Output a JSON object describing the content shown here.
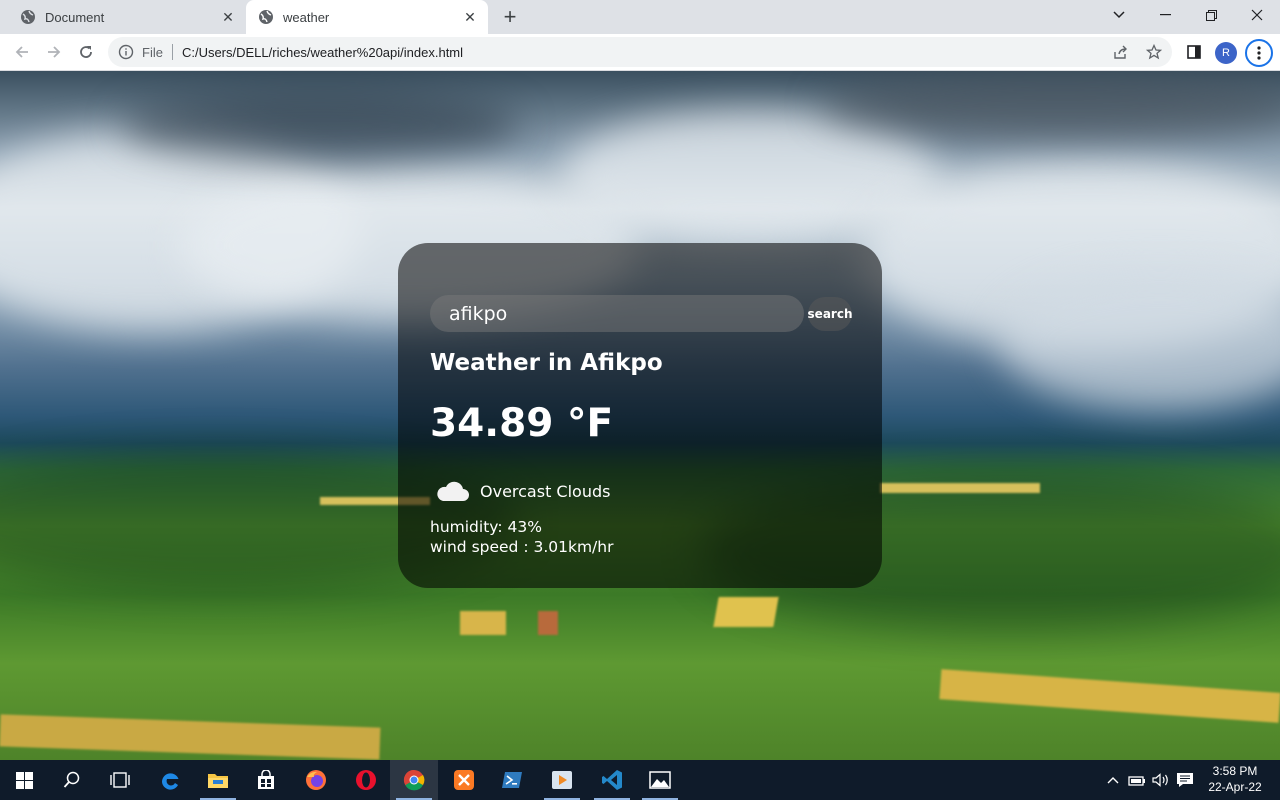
{
  "browser": {
    "tabs": [
      {
        "title": "Document",
        "active": false
      },
      {
        "title": "weather",
        "active": true
      }
    ],
    "new_tab_label": "+",
    "address": {
      "scheme_label": "File",
      "url": "C:/Users/DELL/riches/weather%20api/index.html"
    },
    "profile_initial": "R"
  },
  "weather": {
    "search": {
      "value": "afikpo",
      "placeholder": "Search",
      "button_label": "search"
    },
    "city_heading": "Weather in Afikpo",
    "temperature": "34.89 °F",
    "condition": "Overcast Clouds",
    "condition_icon": "cloud-icon",
    "humidity": "humidity: 43%",
    "wind_speed": "wind speed : 3.01km/hr"
  },
  "taskbar": {
    "apps": [
      "start",
      "search",
      "task-view",
      "edge",
      "file-explorer",
      "store",
      "firefox",
      "opera",
      "chrome",
      "xampp",
      "powershell",
      "media-player",
      "vscode",
      "photos"
    ],
    "active_app": "chrome",
    "clock": {
      "time": "3:58 PM",
      "date": "22-Apr-22"
    }
  },
  "colors": {
    "tabstrip": "#dee1e6",
    "card_background": "rgba(0,0,0,0.55)",
    "taskbar": "#0f1b2a",
    "accent": "#1a73e8"
  }
}
